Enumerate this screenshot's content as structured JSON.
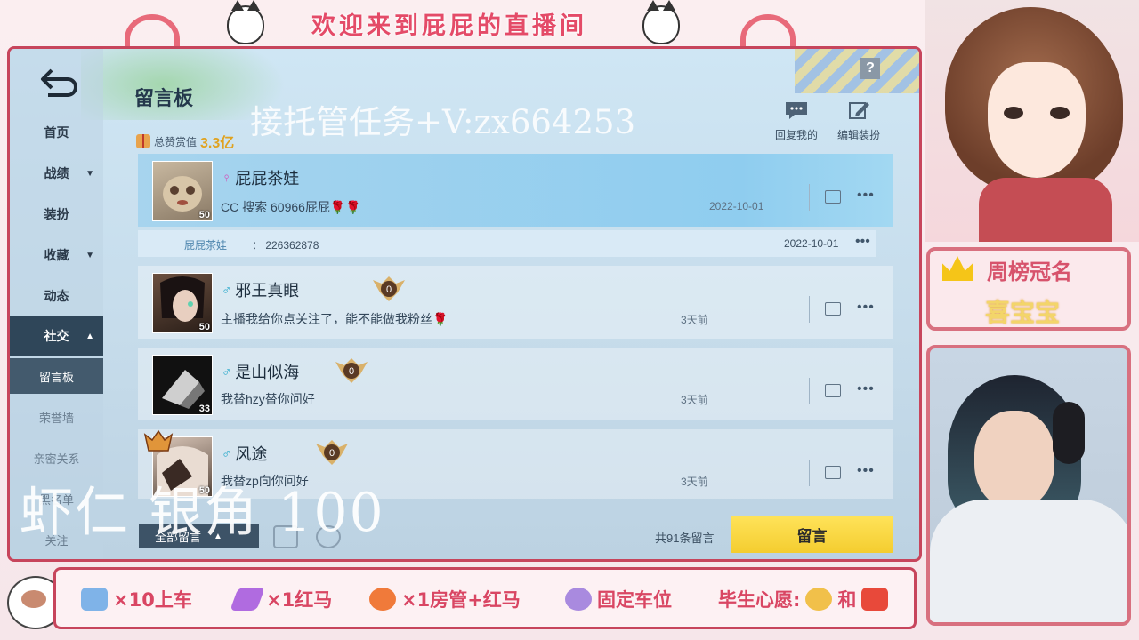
{
  "overlay": {
    "banner_title": "欢迎来到屁屁的直播间",
    "watermark": "接托管任务+V:zx664253",
    "bottom_overlay": "虾仁 银角 100"
  },
  "sidebar": {
    "items": [
      {
        "label": "首页",
        "has_caret": false
      },
      {
        "label": "战绩",
        "has_caret": true
      },
      {
        "label": "装扮",
        "has_caret": false
      },
      {
        "label": "收藏",
        "has_caret": true
      },
      {
        "label": "动态",
        "has_caret": false
      },
      {
        "label": "社交",
        "has_caret": true,
        "expanded": true
      }
    ],
    "sub_items": [
      {
        "label": "留言板",
        "selected": true
      },
      {
        "label": "荣誉墙"
      },
      {
        "label": "亲密关系"
      },
      {
        "label": "黑名单"
      },
      {
        "label": "关注"
      }
    ]
  },
  "board": {
    "title": "留言板",
    "reward_label": "总赞赏值",
    "reward_value": "3.3亿",
    "reply_me_label": "回复我的",
    "edit_label": "编辑装扮",
    "filter_label": "全部留言",
    "total_label": "共91条留言",
    "post_button": "留言"
  },
  "messages": [
    {
      "name": "屁屁茶娃",
      "gender": "♀",
      "level": "50",
      "text": "CC 搜索 60966屁屁🌹🌹",
      "date": "2022-10-01",
      "badge": ""
    },
    {
      "name": "邪王真眼",
      "gender": "♂",
      "level": "50",
      "text": "主播我给你点关注了，能不能做我粉丝🌹",
      "date": "3天前",
      "badge": "0"
    },
    {
      "name": "是山似海",
      "gender": "♂",
      "level": "33",
      "text": "我替hzy替你问好",
      "date": "3天前",
      "badge": "0"
    },
    {
      "name": "风途",
      "gender": "♂",
      "level": "50",
      "text": "我替zp向你问好",
      "date": "3天前",
      "badge": "0"
    }
  ],
  "reply": {
    "who": "屁屁茶娃",
    "text": "： 226362878",
    "date": "2022-10-01"
  },
  "right_panel": {
    "rank_label": "周榜冠名",
    "rank_name": "喜宝宝"
  },
  "bottom_bar": {
    "items": [
      "×10上车",
      "×1红马",
      "×1房管+红马",
      "固定车位",
      "毕生心愿:",
      "和"
    ]
  },
  "colors": {
    "accent_pink": "#c7455c",
    "highlight_blue": "#8fcdef",
    "post_yellow": "#f4cd2f",
    "reward_gold": "#e0a21f"
  }
}
